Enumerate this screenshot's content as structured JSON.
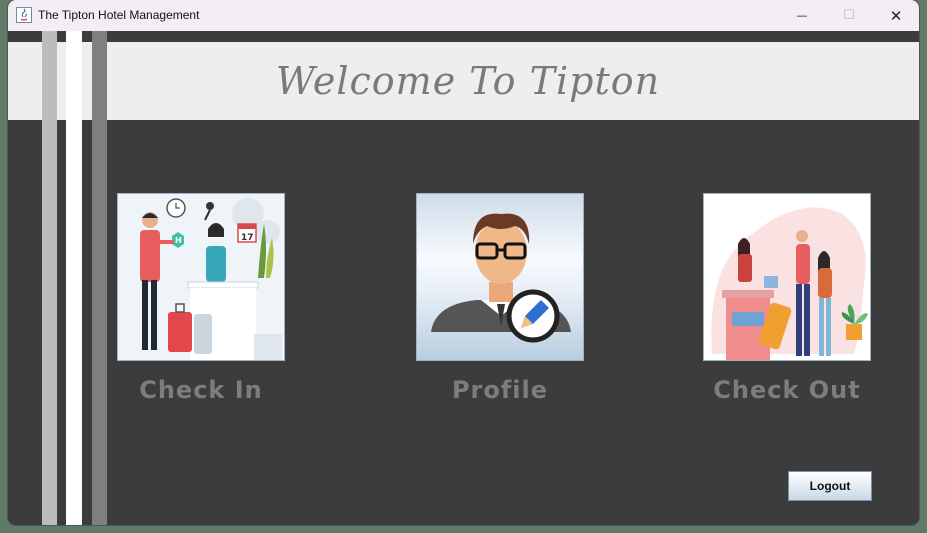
{
  "window": {
    "title": "The Tipton Hotel Management",
    "controls": {
      "minimize": "—",
      "maximize": "☐",
      "close": "✕"
    }
  },
  "header": {
    "welcome": "Welcome To Tipton"
  },
  "tiles": {
    "check_in": {
      "label": "Check In",
      "icon": "receptionist-illustration"
    },
    "profile": {
      "label": "Profile",
      "icon": "user-edit-avatar"
    },
    "check_out": {
      "label": "Check Out",
      "icon": "travelers-departing-illustration"
    }
  },
  "footer": {
    "logout_label": "Logout"
  },
  "colors": {
    "window_bg": "#3c3c3c",
    "header_band": "#eeeeee",
    "welcome_text": "#7a7a7a",
    "label_text": "#7d7d7d"
  }
}
